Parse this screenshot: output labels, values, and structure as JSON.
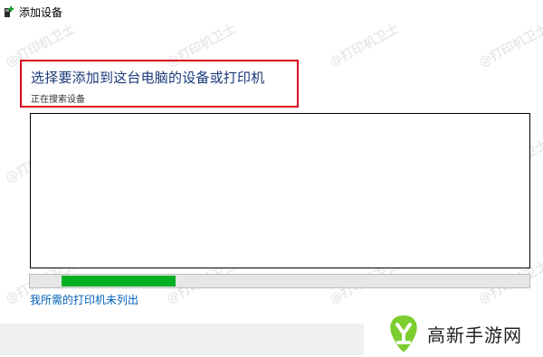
{
  "window": {
    "title": "添加设备",
    "icon": "printer-add-icon"
  },
  "main": {
    "heading": "选择要添加到这台电脑的设备或打印机",
    "status": "正在搜索设备",
    "device_list": [],
    "progress": {
      "indeterminate": true
    },
    "missing_printer_link": "我所需的打印机未列出"
  },
  "watermark": {
    "text": "@打印机卫士"
  },
  "brand": {
    "name": "高新手游网",
    "icon": "brand-logo-icon"
  },
  "colors": {
    "heading": "#1a3a7a",
    "highlight_border": "#d9001b",
    "progress": "#06b025",
    "link": "#0060b8"
  }
}
